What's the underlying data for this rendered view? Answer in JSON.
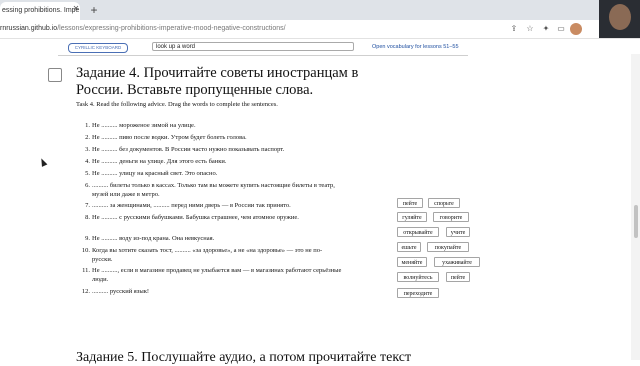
{
  "browser": {
    "tab_title": "essing prohibitions. Impe",
    "tab_close": "✕",
    "new_tab": "+",
    "url_host": "rnrussian.github.io",
    "url_path": "/lessons/expressing-prohibitions-imperative-mood-negative-constructions/"
  },
  "toolbar": {
    "keyboard_label": "CYRILLIC KEYBOARD",
    "lookup_value": "look up a word",
    "vocab_link": "Open vocabulary for lessons 51–55"
  },
  "task": {
    "title": "Задание 4. Прочитайте советы иностранцам в России. Вставьте пропущенные слова.",
    "subtitle": "Task 4. Read the following advice. Drag the words to complete the sentences.",
    "items": [
      {
        "num": "1.",
        "text": "Не .......... мороженое зимой на улице."
      },
      {
        "num": "2.",
        "text": "Не .......... пиво после водки. Утром будет болеть голова."
      },
      {
        "num": "3.",
        "text": "Не .......... без документов. В России часто нужно показывать паспорт."
      },
      {
        "num": "4.",
        "text": "Не .......... деньги на улице. Для этого есть банки."
      },
      {
        "num": "5.",
        "text": "Не .......... улицу на красный свет. Это опасно."
      },
      {
        "num": "6.",
        "text": ".......... билеты только в кассах. Только там вы можете купить настоящие билеты в театр, музей или даже в метро."
      },
      {
        "num": "7.",
        "text": ".......... за женщинами, .......... перед ними дверь — в России так принято."
      },
      {
        "num": "8.",
        "text": "Не .......... с русскими бабушками. Бабушка страшнее, чем атомное оружие."
      },
      {
        "num": "9.",
        "text": "Не .......... воду из-под крана. Она невкусная."
      },
      {
        "num": "10.",
        "text": "Когда вы хотите сказать тост, .......... «за здоровье», а не «на здоровье» — это не по-русски."
      },
      {
        "num": "11.",
        "text": "Не .........., если в магазине продавец не улыбается вам — в магазинах работают серьёзные люди."
      },
      {
        "num": "12.",
        "text": ".......... русский язык!"
      }
    ],
    "word_bank": [
      "пейте",
      "спорьте",
      "гуляйте",
      "говорите",
      "открывайте",
      "учите",
      "ешьте",
      "покупайте",
      "меняйте",
      "ухаживайте",
      "волнуйтесь",
      "пейте",
      "переходите"
    ]
  },
  "next_heading": "Задание 5. Послушайте аудио, а потом прочитайте текст"
}
